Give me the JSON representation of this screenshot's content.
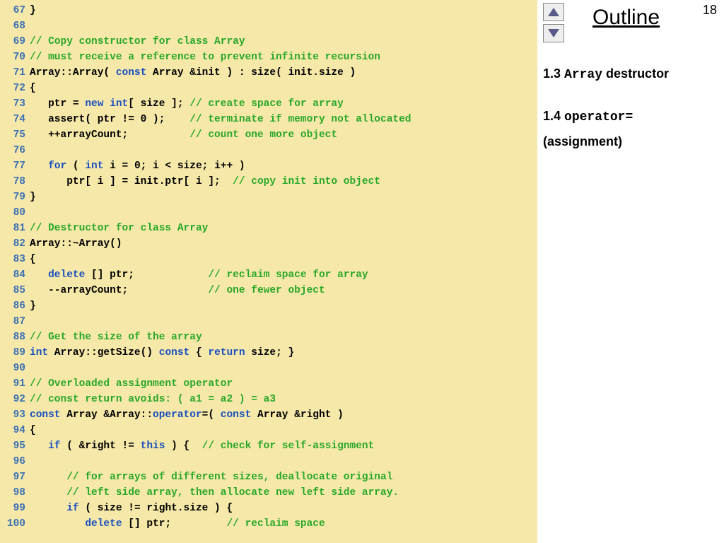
{
  "page_number": "18",
  "outline": {
    "title": "Outline",
    "line1_num": "1.3 ",
    "line1_mono": "Array",
    "line1_rest": " destructor",
    "line2_num": "1.4 ",
    "line2_mono": "operator=",
    "line3": "(assignment)"
  },
  "code": [
    {
      "n": "67",
      "seg": [
        {
          "c": "tx",
          "t": "}"
        }
      ]
    },
    {
      "n": "68",
      "seg": []
    },
    {
      "n": "69",
      "seg": [
        {
          "c": "cm",
          "t": "// Copy constructor for class Array"
        }
      ]
    },
    {
      "n": "70",
      "seg": [
        {
          "c": "cm",
          "t": "// must receive a reference to prevent infinite recursion"
        }
      ]
    },
    {
      "n": "71",
      "seg": [
        {
          "c": "tx",
          "t": "Array::Array( "
        },
        {
          "c": "kw",
          "t": "const"
        },
        {
          "c": "tx",
          "t": " Array &init ) : size( init.size )"
        }
      ]
    },
    {
      "n": "72",
      "seg": [
        {
          "c": "tx",
          "t": "{"
        }
      ]
    },
    {
      "n": "73",
      "seg": [
        {
          "c": "tx",
          "t": "   ptr = "
        },
        {
          "c": "kw",
          "t": "new"
        },
        {
          "c": "tx",
          "t": " "
        },
        {
          "c": "kw",
          "t": "int"
        },
        {
          "c": "tx",
          "t": "[ size ]; "
        },
        {
          "c": "cm",
          "t": "// create space for array"
        }
      ]
    },
    {
      "n": "74",
      "seg": [
        {
          "c": "tx",
          "t": "   assert( ptr != 0 );    "
        },
        {
          "c": "cm",
          "t": "// terminate if memory not allocated"
        }
      ]
    },
    {
      "n": "75",
      "seg": [
        {
          "c": "tx",
          "t": "   ++arrayCount;          "
        },
        {
          "c": "cm",
          "t": "// count one more object"
        }
      ]
    },
    {
      "n": "76",
      "seg": []
    },
    {
      "n": "77",
      "seg": [
        {
          "c": "tx",
          "t": "   "
        },
        {
          "c": "kw",
          "t": "for"
        },
        {
          "c": "tx",
          "t": " ( "
        },
        {
          "c": "kw",
          "t": "int"
        },
        {
          "c": "tx",
          "t": " i = 0; i < size; i++ )"
        }
      ]
    },
    {
      "n": "78",
      "seg": [
        {
          "c": "tx",
          "t": "      ptr[ i ] = init.ptr[ i ];  "
        },
        {
          "c": "cm",
          "t": "// copy init into object"
        }
      ]
    },
    {
      "n": "79",
      "seg": [
        {
          "c": "tx",
          "t": "}"
        }
      ]
    },
    {
      "n": "80",
      "seg": []
    },
    {
      "n": "81",
      "seg": [
        {
          "c": "cm",
          "t": "// Destructor for class Array"
        }
      ]
    },
    {
      "n": "82",
      "seg": [
        {
          "c": "tx",
          "t": "Array::~Array()"
        }
      ]
    },
    {
      "n": "83",
      "seg": [
        {
          "c": "tx",
          "t": "{"
        }
      ]
    },
    {
      "n": "84",
      "seg": [
        {
          "c": "tx",
          "t": "   "
        },
        {
          "c": "kw",
          "t": "delete"
        },
        {
          "c": "tx",
          "t": " [] ptr;            "
        },
        {
          "c": "cm",
          "t": "// reclaim space for array"
        }
      ]
    },
    {
      "n": "85",
      "seg": [
        {
          "c": "tx",
          "t": "   --arrayCount;             "
        },
        {
          "c": "cm",
          "t": "// one fewer object"
        }
      ]
    },
    {
      "n": "86",
      "seg": [
        {
          "c": "tx",
          "t": "}"
        }
      ]
    },
    {
      "n": "87",
      "seg": []
    },
    {
      "n": "88",
      "seg": [
        {
          "c": "cm",
          "t": "// Get the size of the array"
        }
      ]
    },
    {
      "n": "89",
      "seg": [
        {
          "c": "kw",
          "t": "int"
        },
        {
          "c": "tx",
          "t": " Array::getSize() "
        },
        {
          "c": "kw",
          "t": "const"
        },
        {
          "c": "tx",
          "t": " { "
        },
        {
          "c": "kw",
          "t": "return"
        },
        {
          "c": "tx",
          "t": " size; }"
        }
      ]
    },
    {
      "n": "90",
      "seg": []
    },
    {
      "n": "91",
      "seg": [
        {
          "c": "cm",
          "t": "// Overloaded assignment operator"
        }
      ]
    },
    {
      "n": "92",
      "seg": [
        {
          "c": "cm",
          "t": "// const return avoids: ( a1 = a2 ) = a3"
        }
      ]
    },
    {
      "n": "93",
      "seg": [
        {
          "c": "kw",
          "t": "const"
        },
        {
          "c": "tx",
          "t": " Array &Array::"
        },
        {
          "c": "kw",
          "t": "operator"
        },
        {
          "c": "tx",
          "t": "=( "
        },
        {
          "c": "kw",
          "t": "const"
        },
        {
          "c": "tx",
          "t": " Array &right )"
        }
      ]
    },
    {
      "n": "94",
      "seg": [
        {
          "c": "tx",
          "t": "{"
        }
      ]
    },
    {
      "n": "95",
      "seg": [
        {
          "c": "tx",
          "t": "   "
        },
        {
          "c": "kw",
          "t": "if"
        },
        {
          "c": "tx",
          "t": " ( &right != "
        },
        {
          "c": "kw",
          "t": "this"
        },
        {
          "c": "tx",
          "t": " ) {  "
        },
        {
          "c": "cm",
          "t": "// check for self-assignment"
        }
      ]
    },
    {
      "n": "96",
      "seg": []
    },
    {
      "n": "97",
      "seg": [
        {
          "c": "tx",
          "t": "      "
        },
        {
          "c": "cm",
          "t": "// for arrays of different sizes, deallocate original"
        }
      ]
    },
    {
      "n": "98",
      "seg": [
        {
          "c": "tx",
          "t": "      "
        },
        {
          "c": "cm",
          "t": "// left side array, then allocate new left side array."
        }
      ]
    },
    {
      "n": "99",
      "seg": [
        {
          "c": "tx",
          "t": "      "
        },
        {
          "c": "kw",
          "t": "if"
        },
        {
          "c": "tx",
          "t": " ( size != right.size ) {"
        }
      ]
    },
    {
      "n": "100",
      "seg": [
        {
          "c": "tx",
          "t": "         "
        },
        {
          "c": "kw",
          "t": "delete"
        },
        {
          "c": "tx",
          "t": " [] ptr;         "
        },
        {
          "c": "cm",
          "t": "// reclaim space"
        }
      ]
    }
  ]
}
